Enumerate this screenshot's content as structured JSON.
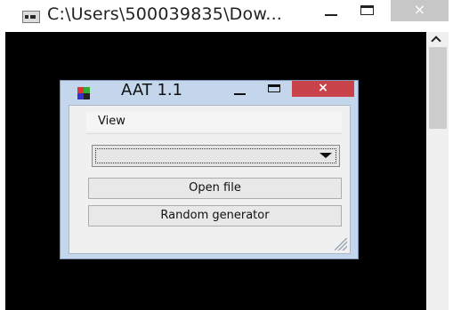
{
  "outer_window": {
    "title": "C:\\Users\\500039835\\Dow...",
    "close_glyph": "×"
  },
  "dialog": {
    "title": "AAT 1.1",
    "close_glyph": "×",
    "menu": {
      "view_label": "View"
    },
    "combo": {
      "selected_value": ""
    },
    "buttons": {
      "open_file": "Open file",
      "random_generator": "Random generator"
    }
  },
  "colors": {
    "dialog_frame": "#c3d6ec",
    "close_button_active": "#c9444a",
    "console_background": "#000000"
  },
  "icons": [
    "console-app-icon",
    "minimize-icon",
    "maximize-icon",
    "close-icon",
    "scroll-up-arrow-icon",
    "aat-app-icon",
    "dropdown-arrow-icon",
    "resize-grip-icon"
  ]
}
